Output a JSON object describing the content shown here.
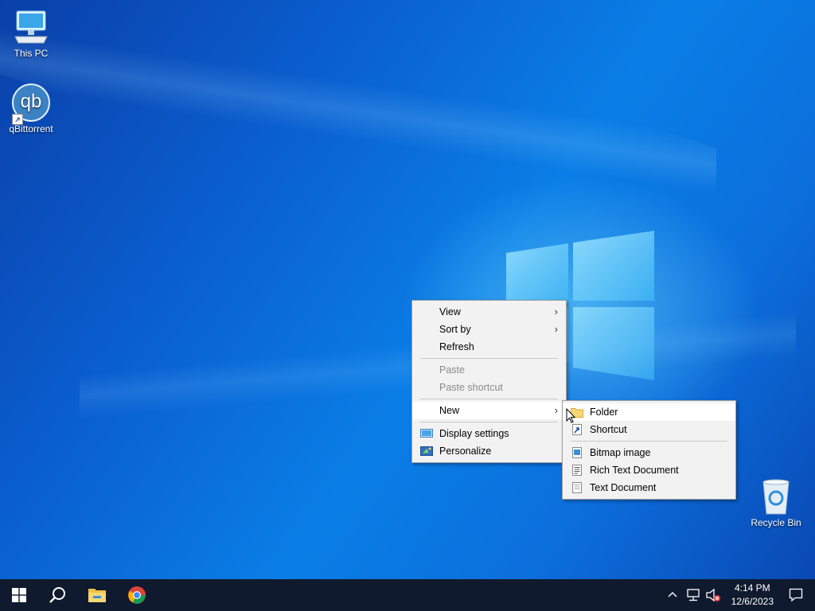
{
  "desktop": {
    "icons": [
      {
        "label": "This PC",
        "icon": "computer-icon"
      },
      {
        "label": "qBittorrent",
        "icon": "qbittorrent-icon",
        "glyph": "qb"
      },
      {
        "label": "Recycle Bin",
        "icon": "recycle-bin-icon"
      }
    ]
  },
  "context_menu": {
    "items": {
      "view": "View",
      "sort_by": "Sort by",
      "refresh": "Refresh",
      "paste": "Paste",
      "paste_shortcut": "Paste shortcut",
      "new": "New",
      "display_settings": "Display settings",
      "personalize": "Personalize"
    }
  },
  "new_submenu": {
    "items": {
      "folder": "Folder",
      "shortcut": "Shortcut",
      "bitmap": "Bitmap image",
      "rich_text": "Rich Text Document",
      "text": "Text Document"
    }
  },
  "taskbar": {
    "time": "4:14 PM",
    "date": "12/6/2023"
  },
  "colors": {
    "taskbar": "#101a2e",
    "menu_bg": "#f2f2f2",
    "folder": "#f8d775",
    "accent": "#0078d7"
  }
}
